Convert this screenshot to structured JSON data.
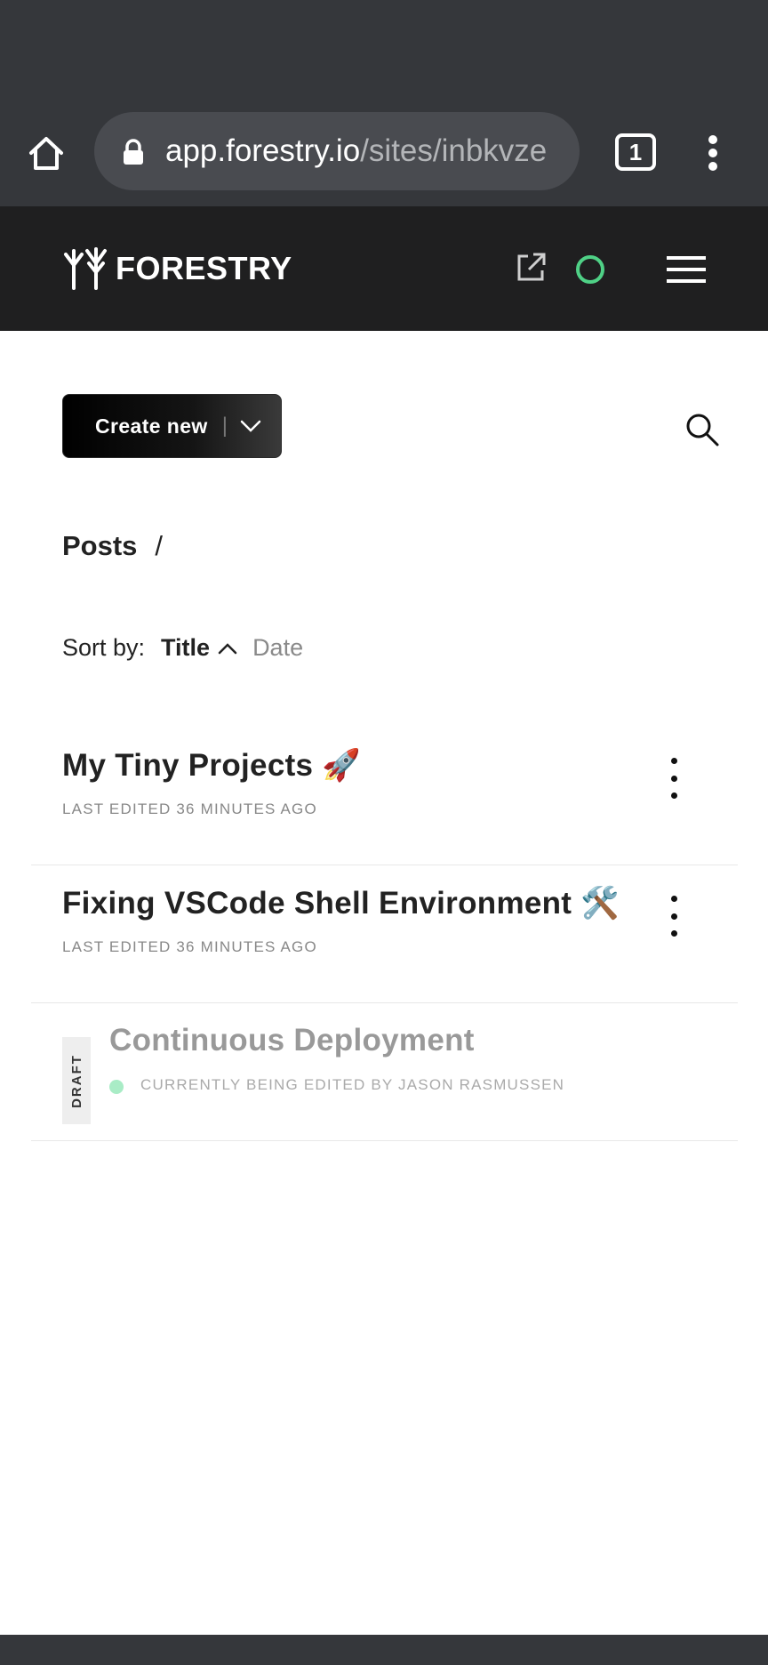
{
  "browser": {
    "url_host": "app.forestry.io",
    "url_path": "/sites/inbkvze",
    "tab_count": "1"
  },
  "header": {
    "brand": "FORESTRY",
    "status_color": "#4fd186"
  },
  "toolbar": {
    "create_label": "Create new",
    "create_separator": "|"
  },
  "breadcrumb": {
    "section": "Posts",
    "separator": "/"
  },
  "sort": {
    "label": "Sort by:",
    "title_option": "Title",
    "date_option": "Date",
    "active": "Title",
    "direction": "ascending"
  },
  "posts": [
    {
      "title": "My Tiny Projects 🚀",
      "meta": "LAST EDITED 36 MINUTES AGO",
      "draft": false
    },
    {
      "title": "Fixing VSCode Shell Environment 🛠️",
      "meta": "LAST EDITED 36 MINUTES AGO",
      "draft": false
    },
    {
      "title": "Continuous Deployment",
      "meta": "CURRENTLY BEING EDITED BY JASON RASMUSSEN",
      "draft": true,
      "badge": "DRAFT"
    }
  ]
}
